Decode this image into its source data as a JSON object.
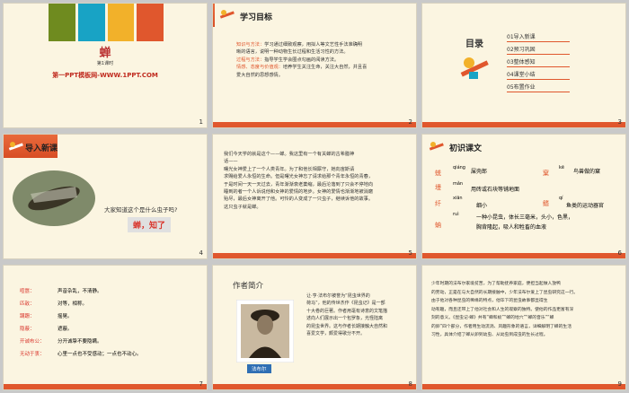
{
  "slide1": {
    "title": "蝉",
    "subtitle": "第1课时",
    "brand": "第一PPT模板网-WWW.1PPT.COM",
    "num": "1"
  },
  "slide2": {
    "heading": "学习目标",
    "lines": [
      {
        "label": "知识与方法：",
        "text": "学习通过细致观察，用拟人等文艺性手法准确明"
      },
      {
        "label": "",
        "text": "晰的语言，说明一种动物生长过程和生活习性的方法。"
      },
      {
        "label": "过程与方法：",
        "text": "指导学生学会圈点勾画的阅读方法。"
      },
      {
        "label": "情感、态度与价值观：",
        "text": "培养学生关注生命，关注大自然，并且喜"
      },
      {
        "label": "",
        "text": "爱大自然的思想感情。"
      }
    ],
    "num": "2"
  },
  "slide3": {
    "heading": "目录",
    "items": [
      "01导入新课",
      "02预习巩固",
      "03整体感知",
      "04课堂小结",
      "05布置作业"
    ],
    "num": "3"
  },
  "slide4": {
    "heading": "导入新课",
    "question": "大家知道这个是什么虫子吗?",
    "answer": "蝉，知了",
    "num": "4"
  },
  "slide5": {
    "lines": [
      "我们今天学的就是这个——蝉。我这里有一个有关蝉的古希腊神",
      "话——",
      "曙光女神爱上了一个人类青年。为了和他长相厮守，她向宙斯请",
      "求赐给爱人永恒的生命。但是曙光女神忘了请求给那个青年永恒的青春，",
      "于是时间一天一天过去，青年渐渐衰老萎缩，最后沦落到了只会不停地向",
      "睡到的者一个人诉说他和女神的爱情的地步。女神的爱情也渐渐地被消磨",
      "殆尽，最后女神离开了他。可怜的人变成了一只虫子，继续诉他的故事。",
      "这只虫子就是蝉。"
    ],
    "num": "5"
  },
  "slide6": {
    "heading": "初识课文",
    "rows": [
      {
        "pinyin": "qiáng",
        "hanzi": "蜣",
        "word": "屎壳郎",
        "pinyin2": "kē",
        "hanzi2": "窠",
        "word2": "鸟兽做的窠"
      },
      {
        "pinyin": "mǎn",
        "hanzi": "墁",
        "word": "用砖或石块等铺地面",
        "pinyin2": "",
        "hanzi2": "",
        "word2": ""
      },
      {
        "pinyin": "xiān",
        "hanzi": "纤",
        "word": "细小",
        "pinyin2": "qí",
        "hanzi2": "鳍",
        "word2": "鱼类的运动器官"
      },
      {
        "pinyin": "ruì",
        "hanzi": "蚋",
        "word": "一种小昆虫，体长三毫米，头小，色黑，",
        "pinyin2": "",
        "hanzi2": "",
        "word2": ""
      },
      {
        "pinyin": "",
        "hanzi": "",
        "word": "胸背隆起，吸人和牲畜的血液",
        "pinyin2": "",
        "hanzi2": "",
        "word2": ""
      }
    ],
    "num": "6"
  },
  "slide7": {
    "rows": [
      {
        "term": "喧嚣：",
        "def": "声音杂乱，不清静。"
      },
      {
        "term": "匹敌：",
        "def": "对等，相称。"
      },
      {
        "term": "蹒跚：",
        "def": "摇晃。"
      },
      {
        "term": "隐蔽：",
        "def": "遮蔽。"
      },
      {
        "term": "开诚布公：",
        "def": "分开诚挚不要隐瞒。"
      },
      {
        "term": "无动于衷：",
        "def": "心里一点也不受感动；一点也不动心。"
      }
    ],
    "num": "7"
  },
  "slide8": {
    "heading": "作者简介",
    "caption": "法布尔",
    "lines": [
      "让·亨·法布尔被誉为“昆虫世界的",
      "荷马”，他的传世杰作《昆虫记》是一部",
      "十大卷的巨著。作者用毫有诗意的文笔描",
      "述向人们展示出一个包罗象，光怪陆离",
      "的昆虫世界。这与作者长期接触大自然和",
      "喜爱文学，颇爱得歌分不开。"
    ],
    "num": "8"
  },
  "slide9": {
    "lines": [
      "少年时期的法布尔家境贫苦，为了帮助抚养家庭，便担当起做人放鸭",
      "的劳动，正是在与大自然的长期接触中，少年法布尔爱上了昆虫研究这一行。",
      "由于他对各种昆虫的稀缘的特点，他毕下的昆虫故事都显得生",
      "动有趣，而且还带上了他对社会和人生的观察的独特。使他的作品更富有深",
      "刻的意义。《昆虫记·蝉》共有“蝉和蚁”“蝉的地穴”“蝉的音乐”“蝉",
      "的卵”四个部分，作者用生动流淌、风趣形象的语言，详细解明了蝉的生活",
      "习性，具体介绍了蝉从卵到幼虫、从幼虫到成虫的生长过程。"
    ],
    "num": "9"
  },
  "colors": {
    "accent": "#e0572d",
    "bg": "#fbf5e1",
    "green": "#5aa02c"
  }
}
